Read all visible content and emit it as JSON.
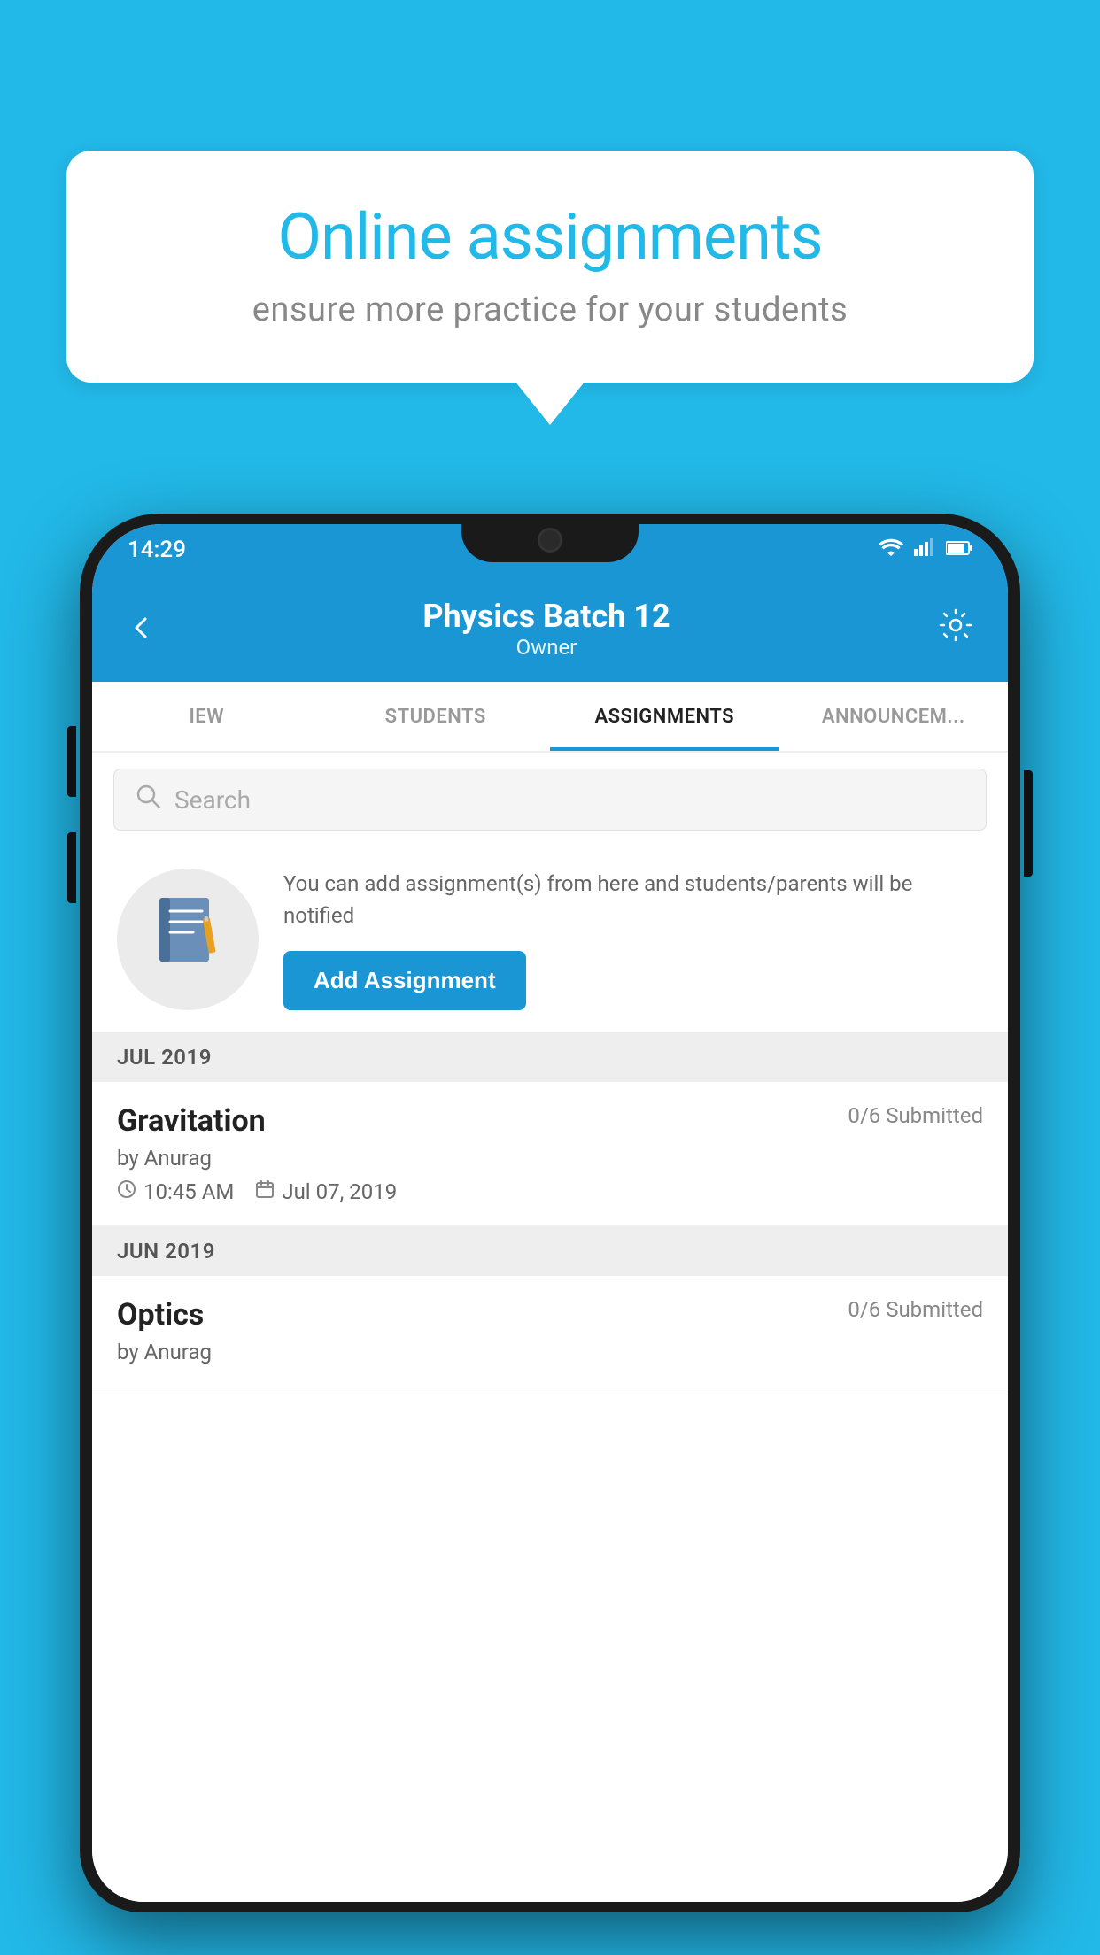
{
  "background_color": "#22b8e8",
  "speech_bubble": {
    "title": "Online assignments",
    "subtitle": "ensure more practice for your students"
  },
  "status_bar": {
    "time": "14:29",
    "wifi_icon": "wifi",
    "signal_icon": "signal",
    "battery_icon": "battery"
  },
  "header": {
    "title": "Physics Batch 12",
    "subtitle": "Owner",
    "back_icon": "back-arrow",
    "settings_icon": "gear"
  },
  "tabs": [
    {
      "label": "IEW",
      "active": false
    },
    {
      "label": "STUDENTS",
      "active": false
    },
    {
      "label": "ASSIGNMENTS",
      "active": true
    },
    {
      "label": "ANNOUNCEM...",
      "active": false
    }
  ],
  "search": {
    "placeholder": "Search",
    "search_icon": "magnifier"
  },
  "promo": {
    "description": "You can add assignment(s) from here and students/parents will be notified",
    "button_label": "Add Assignment",
    "icon": "📓"
  },
  "sections": [
    {
      "label": "JUL 2019",
      "assignments": [
        {
          "name": "Gravitation",
          "submitted": "0/6 Submitted",
          "by": "by Anurag",
          "time": "10:45 AM",
          "date": "Jul 07, 2019"
        }
      ]
    },
    {
      "label": "JUN 2019",
      "assignments": [
        {
          "name": "Optics",
          "submitted": "0/6 Submitted",
          "by": "by Anurag",
          "time": "",
          "date": ""
        }
      ]
    }
  ]
}
